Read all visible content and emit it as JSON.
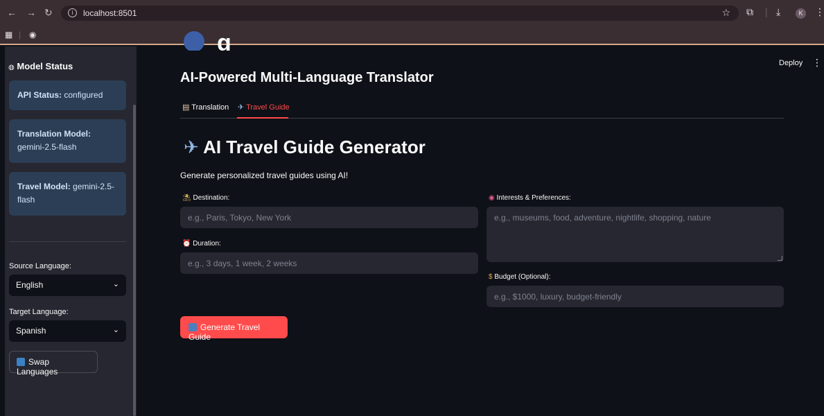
{
  "browser": {
    "url": "localhost:8501",
    "profile_initial": "K"
  },
  "sidebar": {
    "section_title": "Model Status",
    "status_cards": [
      {
        "label": "API Status:",
        "value": "configured"
      },
      {
        "label": "Translation Model:",
        "value": "gemini-2.5-flash"
      },
      {
        "label": "Travel Model:",
        "value": "gemini-2.5-flash"
      }
    ],
    "source_language_label": "Source Language:",
    "source_language_value": "English",
    "target_language_label": "Target Language:",
    "target_language_value": "Spanish",
    "swap_button": "Swap Languages"
  },
  "header": {
    "deploy": "Deploy",
    "subtitle": "AI-Powered Multi-Language Translator"
  },
  "tabs": [
    {
      "label": "Translation",
      "active": false
    },
    {
      "label": "Travel Guide",
      "active": true
    }
  ],
  "travel": {
    "heading": "AI Travel Guide Generator",
    "lead": "Generate personalized travel guides using AI!",
    "destination_label": "Destination:",
    "destination_placeholder": "e.g., Paris, Tokyo, New York",
    "duration_label": "Duration:",
    "duration_placeholder": "e.g., 3 days, 1 week, 2 weeks",
    "interests_label": "Interests & Preferences:",
    "interests_placeholder": "e.g., museums, food, adventure, nightlife, shopping, nature",
    "budget_label": "Budget (Optional):",
    "budget_placeholder": "e.g., $1000, luxury, budget-friendly",
    "generate_button": "Generate Travel Guide"
  },
  "colors": {
    "accent": "#ff4b4b",
    "background": "#0e1117",
    "sidebar": "#262730",
    "status_card": "#2b3e55"
  }
}
